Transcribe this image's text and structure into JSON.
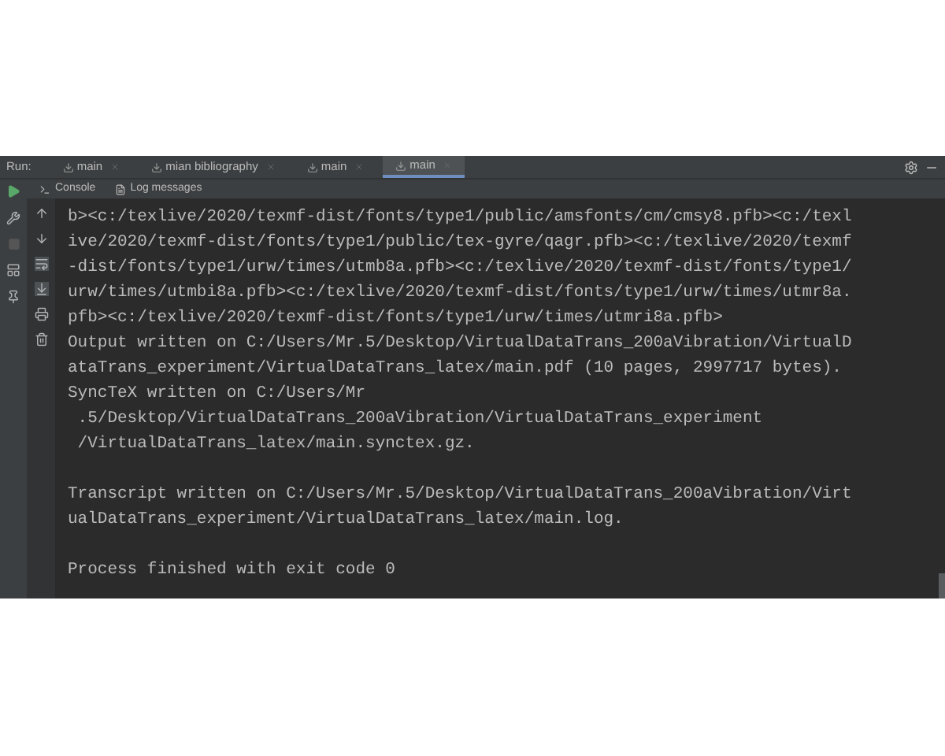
{
  "run_bar": {
    "label": "Run:",
    "tabs": [
      {
        "label": "main",
        "selected": false
      },
      {
        "label": "mian bibliography",
        "selected": false
      },
      {
        "label": "main",
        "selected": false
      },
      {
        "label": "main",
        "selected": true
      }
    ]
  },
  "sub_tabs": [
    {
      "label": "Console"
    },
    {
      "label": "Log messages"
    }
  ],
  "console": {
    "blocks": [
      {
        "lines": [
          "b><c:/texlive/2020/texmf-dist/fonts/type1/public/amsfonts/cm/cmsy8.pfb><c:/texl",
          "ive/2020/texmf-dist/fonts/type1/public/tex-gyre/qagr.pfb><c:/texlive/2020/texmf",
          "-dist/fonts/type1/urw/times/utmb8a.pfb><c:/texlive/2020/texmf-dist/fonts/type1/",
          "urw/times/utmbi8a.pfb><c:/texlive/2020/texmf-dist/fonts/type1/urw/times/utmr8a.",
          "pfb><c:/texlive/2020/texmf-dist/fonts/type1/urw/times/utmri8a.pfb>",
          "Output written on C:/Users/Mr.5/Desktop/VirtualDataTrans_200aVibration/VirtualD",
          "ataTrans_experiment/VirtualDataTrans_latex/main.pdf (10 pages, 2997717 bytes).",
          "SyncTeX written on C:/Users/Mr",
          " .5/Desktop/VirtualDataTrans_200aVibration/VirtualDataTrans_experiment",
          " /VirtualDataTrans_latex/main.synctex.gz."
        ]
      },
      {
        "lines": [
          "Transcript written on C:/Users/Mr.5/Desktop/VirtualDataTrans_200aVibration/Virt",
          "ualDataTrans_experiment/VirtualDataTrans_latex/main.log."
        ]
      },
      {
        "lines": [
          "Process finished with exit code 0"
        ]
      }
    ]
  }
}
